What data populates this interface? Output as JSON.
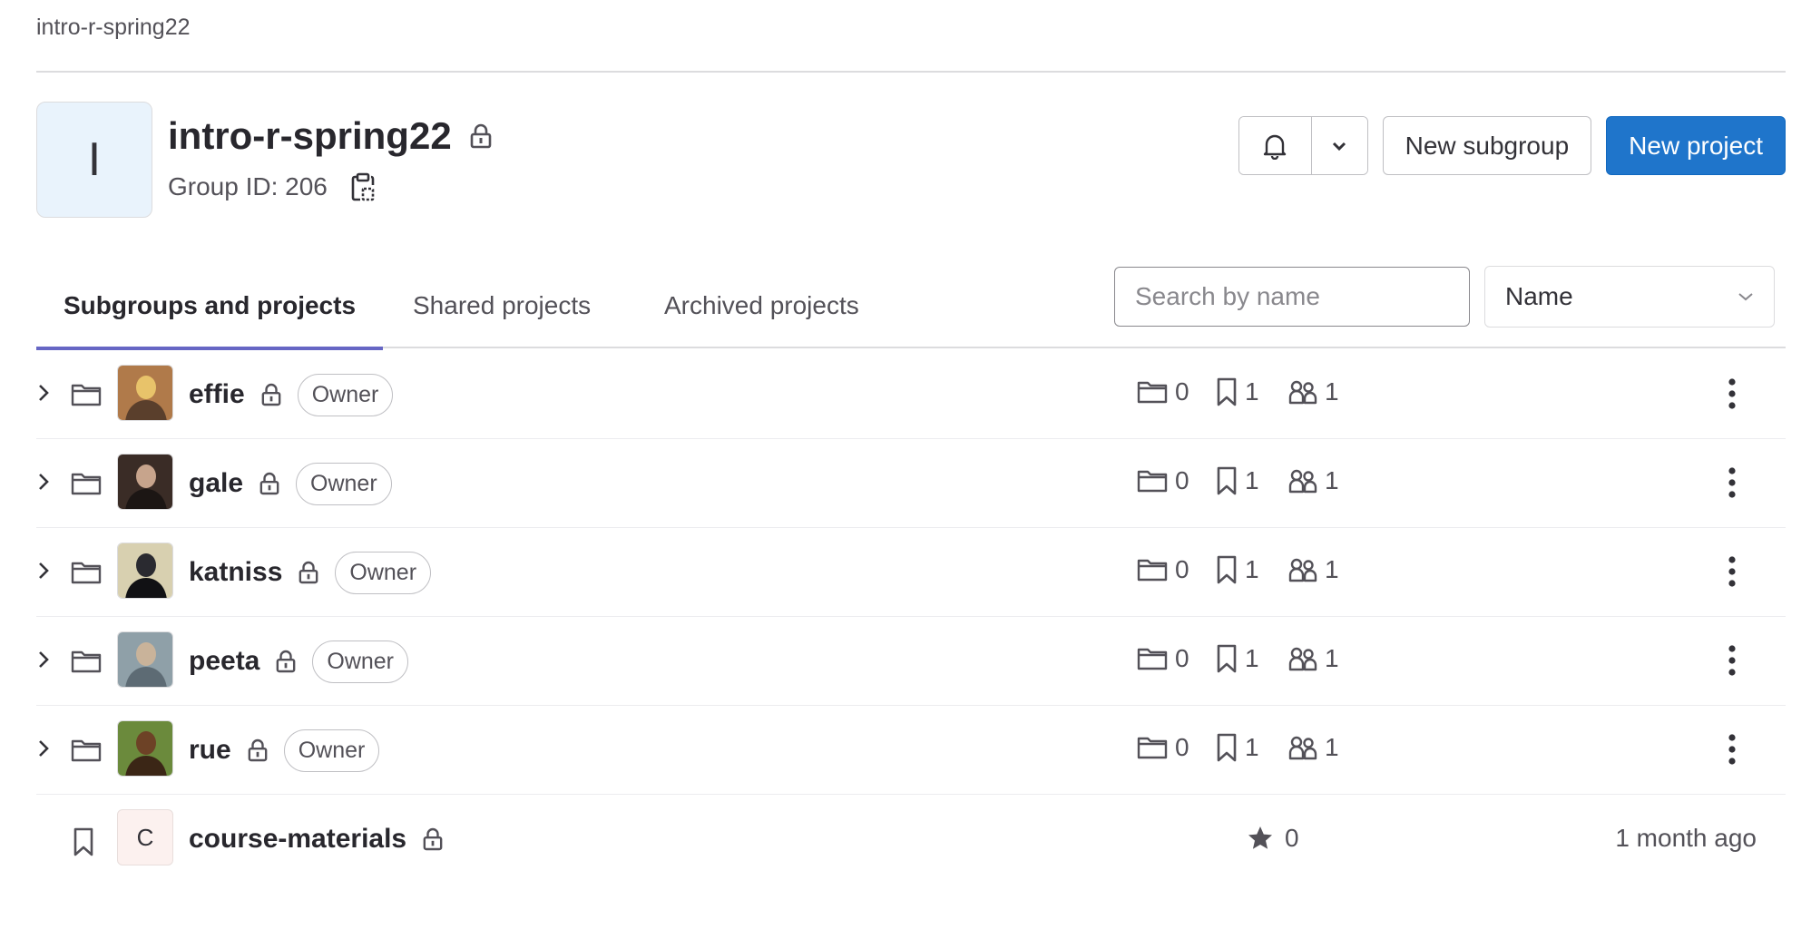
{
  "breadcrumb": "intro-r-spring22",
  "group": {
    "avatar_letter": "I",
    "name": "intro-r-spring22",
    "id_label": "Group ID: 206"
  },
  "actions": {
    "new_subgroup": "New subgroup",
    "new_project": "New project"
  },
  "tabs": [
    {
      "label": "Subgroups and projects",
      "active": true
    },
    {
      "label": "Shared projects",
      "active": false
    },
    {
      "label": "Archived projects",
      "active": false
    }
  ],
  "search": {
    "placeholder": "Search by name"
  },
  "sort": {
    "selected": "Name"
  },
  "subgroups": [
    {
      "name": "effie",
      "role": "Owner",
      "subgroups": "0",
      "projects": "1",
      "members": "1",
      "avatar_colors": [
        "#b07a4a",
        "#e8c36a",
        "#5a3f2c"
      ]
    },
    {
      "name": "gale",
      "role": "Owner",
      "subgroups": "0",
      "projects": "1",
      "members": "1",
      "avatar_colors": [
        "#3a2c26",
        "#c7a48c",
        "#1c1614"
      ]
    },
    {
      "name": "katniss",
      "role": "Owner",
      "subgroups": "0",
      "projects": "1",
      "members": "1",
      "avatar_colors": [
        "#d8d0b0",
        "#2a2a30",
        "#111114"
      ]
    },
    {
      "name": "peeta",
      "role": "Owner",
      "subgroups": "0",
      "projects": "1",
      "members": "1",
      "avatar_colors": [
        "#8fa0a8",
        "#c9b39a",
        "#5d6b74"
      ]
    },
    {
      "name": "rue",
      "role": "Owner",
      "subgroups": "0",
      "projects": "1",
      "members": "1",
      "avatar_colors": [
        "#6b8a3c",
        "#6d4226",
        "#3b2616"
      ]
    }
  ],
  "project": {
    "avatar_letter": "C",
    "name": "course-materials",
    "stars": "0",
    "updated": "1 month ago"
  },
  "colors": {
    "primary": "#1f75cb",
    "tab_underline": "#6666c4",
    "group_avatar_bg": "#e9f3fc",
    "project_avatar_bg": "#fcf1ef"
  }
}
